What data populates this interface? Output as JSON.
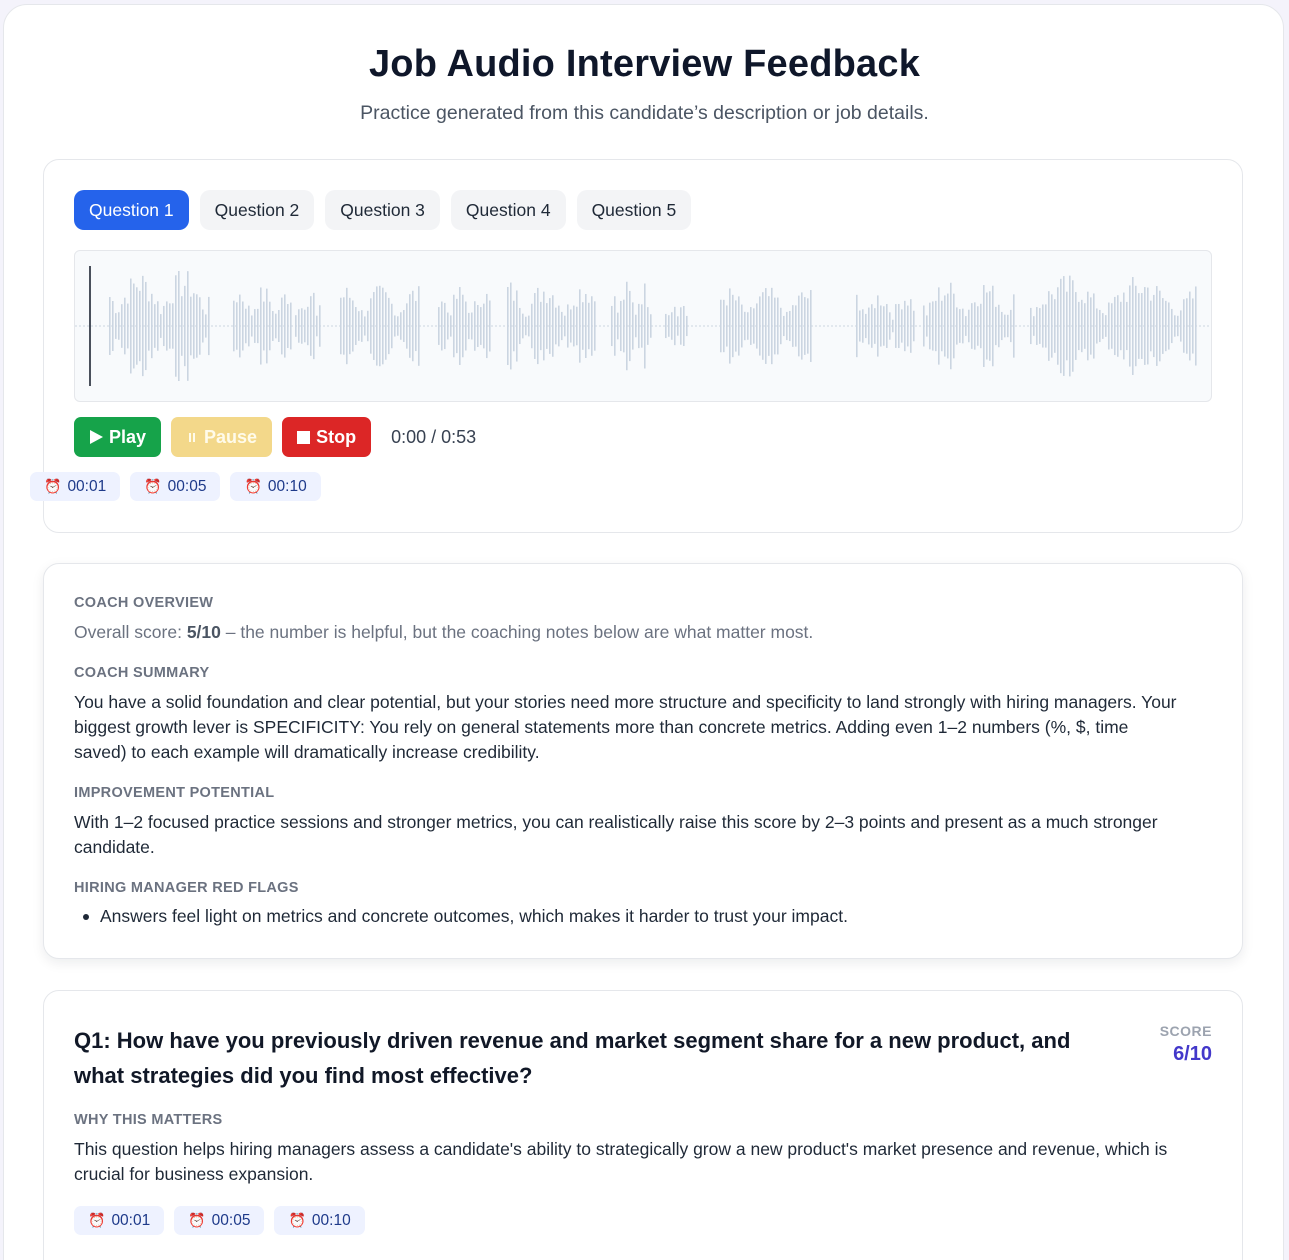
{
  "page": {
    "title": "Job Audio Interview Feedback",
    "subtitle": "Practice generated from this candidate’s description or job details."
  },
  "player": {
    "tabs": [
      {
        "label": "Question 1",
        "active": true
      },
      {
        "label": "Question 2",
        "active": false
      },
      {
        "label": "Question 3",
        "active": false
      },
      {
        "label": "Question 4",
        "active": false
      },
      {
        "label": "Question 5",
        "active": false
      }
    ],
    "controls": {
      "play_label": "Play",
      "pause_label": "Pause",
      "stop_label": "Stop",
      "play_icon": "play-icon",
      "pause_icon": "pause-icon",
      "stop_icon": "stop-icon"
    },
    "time": "0:00 / 0:53",
    "progress": 0,
    "timestamps": [
      "00:01",
      "00:05",
      "00:10"
    ]
  },
  "coach": {
    "overview_label": "COACH OVERVIEW",
    "overview_prefix": "Overall score: ",
    "overview_score": "5/10",
    "overview_suffix": " – the number is helpful, but the coaching notes below are what matter most.",
    "summary_label": "COACH SUMMARY",
    "summary_text": "You have a solid foundation and clear potential, but your stories need more structure and specificity to land strongly with hiring managers. Your biggest growth lever is SPECIFICITY: You rely on general statements more than concrete metrics. Adding even 1–2 numbers (%, $, time saved) to each example will dramatically increase credibility.",
    "improvement_label": "IMPROVEMENT POTENTIAL",
    "improvement_text": "With 1–2 focused practice sessions and stronger metrics, you can realistically raise this score by 2–3 points and present as a much stronger candidate.",
    "red_flags_label": "HIRING MANAGER RED FLAGS",
    "red_flags": [
      "Answers feel light on metrics and concrete outcomes, which makes it harder to trust your impact."
    ]
  },
  "q1": {
    "title": "Q1: How have you previously driven revenue and market segment share for a new product, and what strategies did you find most effective?",
    "score_label": "SCORE",
    "score_value": "6/10",
    "why_label": "WHY THIS MATTERS",
    "why_text": "This question helps hiring managers assess a candidate's ability to strategically grow a new product's market presence and revenue, which is crucial for business expansion.",
    "timestamps": [
      "00:01",
      "00:05",
      "00:10"
    ]
  },
  "colors": {
    "accent": "#2563eb",
    "play": "#16a34a",
    "pause": "#f3d88a",
    "stop": "#dc2626",
    "score": "#4338ca",
    "waveform": "#cbd5e1",
    "clock": "#e11d48"
  },
  "icons": {
    "timestamp_icon": "alarm-clock-icon"
  }
}
